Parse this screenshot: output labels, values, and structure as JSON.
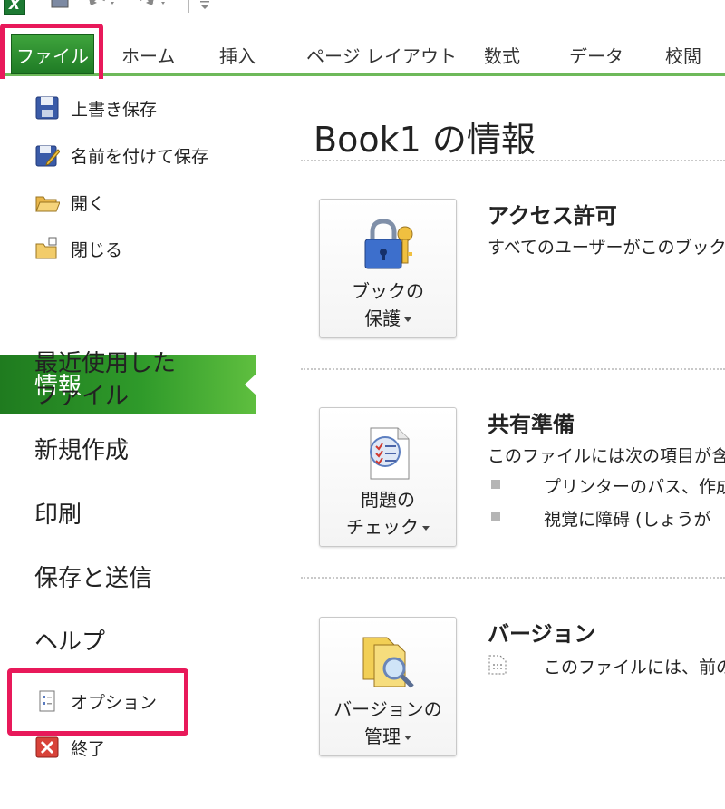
{
  "app": {
    "logo": "X",
    "accent_color": "#2a8f2a",
    "highlight_color": "#e8195a"
  },
  "ribbon": {
    "file_tab": "ファイル",
    "tabs": [
      "ホーム",
      "挿入",
      "ページ レイアウト",
      "数式",
      "データ",
      "校閲"
    ]
  },
  "backstage_nav": {
    "commands": [
      {
        "label": "上書き保存",
        "icon": "save-icon"
      },
      {
        "label": "名前を付けて保存",
        "icon": "save-as-icon"
      },
      {
        "label": "開く",
        "icon": "open-folder-icon"
      },
      {
        "label": "閉じる",
        "icon": "close-folder-icon"
      }
    ],
    "active_item": "情報",
    "items": [
      "最近使用した\nファイル",
      "新規作成",
      "印刷",
      "保存と送信",
      "ヘルプ"
    ],
    "options": {
      "label": "オプション",
      "icon": "options-icon"
    },
    "exit": {
      "label": "終了",
      "icon": "exit-icon"
    }
  },
  "main": {
    "title": "Book1 の情報",
    "sections": [
      {
        "button_line1": "ブックの",
        "button_line2": "保護",
        "button_icon": "lock-key-icon",
        "heading": "アクセス許可",
        "description": "すべてのユーザーがこのブック"
      },
      {
        "button_line1": "問題の",
        "button_line2": "チェック",
        "button_icon": "checklist-icon",
        "heading": "共有準備",
        "description": "このファイルには次の項目が含",
        "bullets": [
          "プリンターのパス、作成",
          "視覚に障碍 (しょうが"
        ]
      },
      {
        "button_line1": "バージョンの",
        "button_line2": "管理",
        "button_icon": "versions-icon",
        "heading": "バージョン",
        "description": "このファイルには、前の"
      }
    ]
  }
}
